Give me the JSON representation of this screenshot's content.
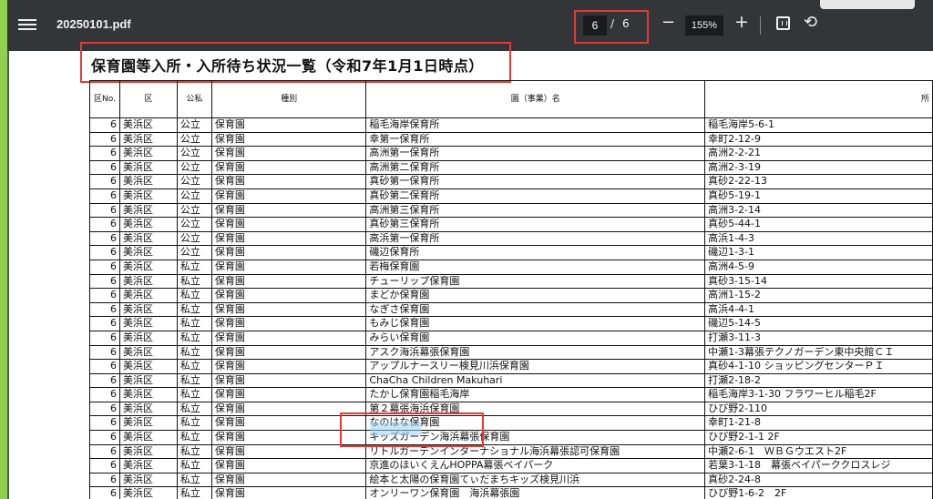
{
  "toolbar": {
    "file_name": "20250101.pdf",
    "page_current": "6",
    "page_separator": "/",
    "page_total": "6",
    "zoom_out": "−",
    "zoom": "155%",
    "zoom_in": "+",
    "rotate": "⟲"
  },
  "document": {
    "title": "保育園等入所・入所待ち状況一覧（令和7年1月1日時点）",
    "headers": [
      "区No.",
      "区",
      "公私",
      "種別",
      "園（事業）名",
      "所"
    ],
    "rows": [
      [
        "6",
        "美浜区",
        "公立",
        "保育園",
        "稲毛海岸保育所",
        "稲毛海岸5-6-1"
      ],
      [
        "6",
        "美浜区",
        "公立",
        "保育園",
        "幸第一保育所",
        "幸町2-12-9"
      ],
      [
        "6",
        "美浜区",
        "公立",
        "保育園",
        "高洲第一保育所",
        "高洲2-2-21"
      ],
      [
        "6",
        "美浜区",
        "公立",
        "保育園",
        "高洲第二保育所",
        "高洲2-3-19"
      ],
      [
        "6",
        "美浜区",
        "公立",
        "保育園",
        "真砂第一保育所",
        "真砂2-22-13"
      ],
      [
        "6",
        "美浜区",
        "公立",
        "保育園",
        "真砂第二保育所",
        "真砂5-19-1"
      ],
      [
        "6",
        "美浜区",
        "公立",
        "保育園",
        "高洲第三保育所",
        "高洲3-2-14"
      ],
      [
        "6",
        "美浜区",
        "公立",
        "保育園",
        "真砂第三保育所",
        "真砂5-44-1"
      ],
      [
        "6",
        "美浜区",
        "公立",
        "保育園",
        "高浜第一保育所",
        "高浜1-4-3"
      ],
      [
        "6",
        "美浜区",
        "公立",
        "保育園",
        "磯辺保育所",
        "磯辺1-3-1"
      ],
      [
        "6",
        "美浜区",
        "私立",
        "保育園",
        "若梅保育園",
        "高洲4-5-9"
      ],
      [
        "6",
        "美浜区",
        "私立",
        "保育園",
        "チューリップ保育園",
        "真砂3-15-14"
      ],
      [
        "6",
        "美浜区",
        "私立",
        "保育園",
        "まどか保育園",
        "高洲1-15-2"
      ],
      [
        "6",
        "美浜区",
        "私立",
        "保育園",
        "なぎさ保育園",
        "高浜4-4-1"
      ],
      [
        "6",
        "美浜区",
        "私立",
        "保育園",
        "もみじ保育園",
        "磯辺5-14-5"
      ],
      [
        "6",
        "美浜区",
        "私立",
        "保育園",
        "みらい保育園",
        "打瀬3-11-3"
      ],
      [
        "6",
        "美浜区",
        "私立",
        "保育園",
        "アスク海浜幕張保育園",
        "中瀬1-3幕張テクノガーデン東中央館ＣＩ"
      ],
      [
        "6",
        "美浜区",
        "私立",
        "保育園",
        "アップルナースリー検見川浜保育園",
        "真砂4-1-10 ショッピングセンターＰＩ"
      ],
      [
        "6",
        "美浜区",
        "私立",
        "保育園",
        "ChaCha Children Makuhari",
        "打瀬2-18-2"
      ],
      [
        "6",
        "美浜区",
        "私立",
        "保育園",
        "たかし保育園稲毛海岸",
        "稲毛海岸3-1-30 フラワーヒル稲毛2F"
      ],
      [
        "6",
        "美浜区",
        "私立",
        "保育園",
        "第２幕張海浜保育園",
        "ひび野2-110"
      ],
      [
        "6",
        "美浜区",
        "私立",
        "保育園",
        "なのはな保育園",
        "幸町1-21-8"
      ],
      [
        "6",
        "美浜区",
        "私立",
        "保育園",
        "キッズガーデン海浜幕張保育園",
        "ひび野2-1-1 2F"
      ],
      [
        "6",
        "美浜区",
        "私立",
        "保育園",
        "リトルガーデンインターナショナル海浜幕張認可保育園",
        "中瀬2-6-1　ＷＢＧウエスト2F"
      ],
      [
        "6",
        "美浜区",
        "私立",
        "保育園",
        "京進のほいくえんHOPPA幕張ベイパーク",
        "若葉3-1-18　幕張ベイパーククロスレジ"
      ],
      [
        "6",
        "美浜区",
        "私立",
        "保育園",
        "絵本と太陽の保育園てぃだまちキッズ検見川浜",
        "真砂2-24-8"
      ],
      [
        "6",
        "美浜区",
        "私立",
        "保育園",
        "オンリーワン保育園　海浜幕張園",
        "ひび野1-6-2　2F"
      ]
    ]
  }
}
